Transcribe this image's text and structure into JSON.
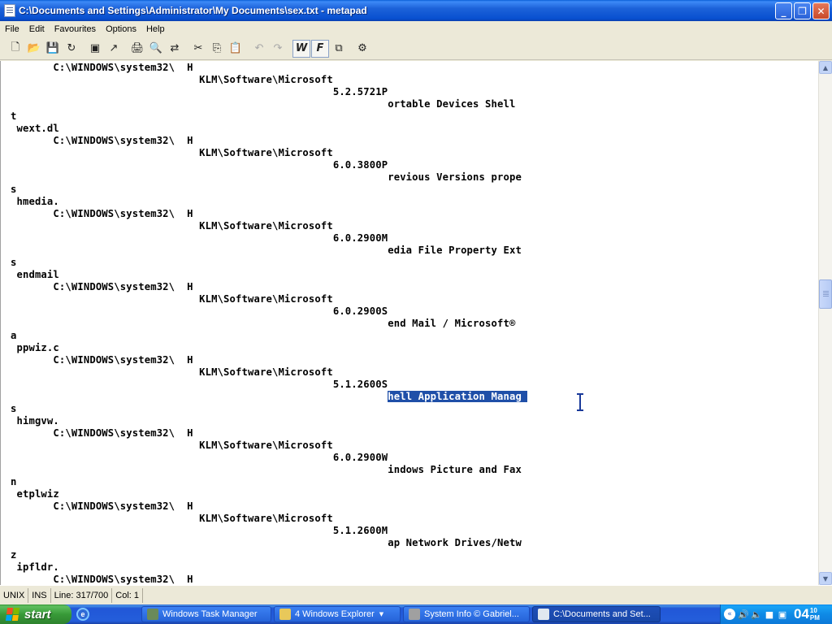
{
  "window": {
    "title": "C:\\Documents and Settings\\Administrator\\My Documents\\sex.txt - metapad",
    "minimize": "_",
    "maximize": "❐",
    "close": "✕"
  },
  "menu": [
    "File",
    "Edit",
    "Favourites",
    "Options",
    "Help"
  ],
  "toolbar": {
    "new": "🗋",
    "open": "📂",
    "save": "💾",
    "revert": "↻",
    "page": "▣",
    "launch": "↗",
    "print": "🖨",
    "find": "🔍",
    "replace": "⇄",
    "cut": "✂",
    "copy": "⎘",
    "paste": "📋",
    "undo": "↶",
    "redo": "↷",
    "wordwrap": "W",
    "font": "F",
    "ontop": "⧉",
    "settings": "⚙"
  },
  "editor": {
    "lines": [
      "       C:\\WINDOWS\\system32\\  H",
      "                               KLM\\Software\\Microsoft",
      "                                                     5.2.5721P",
      "                                                              ortable Devices Shell",
      "t",
      " wext.dl",
      "       C:\\WINDOWS\\system32\\  H",
      "                               KLM\\Software\\Microsoft",
      "                                                     6.0.3800P",
      "                                                              revious Versions prope",
      "s",
      " hmedia.",
      "       C:\\WINDOWS\\system32\\  H",
      "                               KLM\\Software\\Microsoft",
      "                                                     6.0.2900M",
      "                                                              edia File Property Ext",
      "s",
      " endmail",
      "       C:\\WINDOWS\\system32\\  H",
      "                               KLM\\Software\\Microsoft",
      "                                                     6.0.2900S",
      "                                                              end Mail / Microsoft®",
      "a",
      " ppwiz.c",
      "       C:\\WINDOWS\\system32\\  H",
      "                               KLM\\Software\\Microsoft",
      "                                                     5.1.2600S",
      "                                                              hell Application Manag",
      "s",
      " himgvw.",
      "       C:\\WINDOWS\\system32\\  H",
      "                               KLM\\Software\\Microsoft",
      "                                                     6.0.2900W",
      "                                                              indows Picture and Fax",
      "n",
      " etplwiz",
      "       C:\\WINDOWS\\system32\\  H",
      "                               KLM\\Software\\Microsoft",
      "                                                     5.1.2600M",
      "                                                              ap Network Drives/Netw",
      "z",
      " ipfldr.",
      "       C:\\WINDOWS\\system32\\  H"
    ],
    "selected_line_index": 27,
    "selected_text": "hell Application Manag "
  },
  "status": {
    "format": "UNIX",
    "mode": "INS",
    "line": "Line: 317/700",
    "col": "Col: 1"
  },
  "taskbar": {
    "start_label": "start",
    "quicklaunch_icon": "e",
    "tasks": [
      {
        "label": "Windows Task Manager",
        "count": "",
        "has_arrow": false,
        "active": false,
        "icon_color": "#6a8a5a"
      },
      {
        "label": "Windows Explorer",
        "count": "4",
        "has_arrow": true,
        "active": false,
        "icon_color": "#e8c85a"
      },
      {
        "label": "System Info  © Gabriel...",
        "count": "",
        "has_arrow": false,
        "active": false,
        "icon_color": "#a0a0a0"
      },
      {
        "label": "C:\\Documents and Set...",
        "count": "",
        "has_arrow": false,
        "active": true,
        "icon_color": "#e0e8f0"
      }
    ],
    "tray_chevron": "«",
    "tray_icons": [
      "🔊",
      "🔈",
      "■",
      "▣"
    ],
    "clock_hour": "04",
    "clock_min": "10",
    "clock_ampm": "PM"
  },
  "colors": {
    "selection": "#1f4fa8",
    "titlebar": "#0850d0",
    "start_green": "#389a38"
  }
}
